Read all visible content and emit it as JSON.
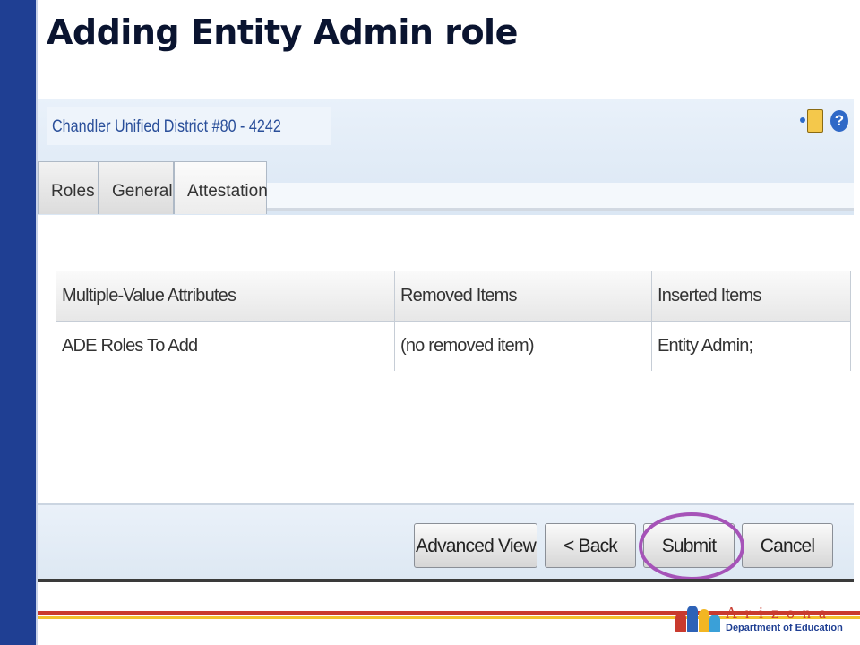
{
  "slide": {
    "title": "Adding Entity Admin role"
  },
  "app": {
    "org_title": "Chandler Unified District #80 - 4242",
    "tabs": [
      {
        "label": "Roles"
      },
      {
        "label": "General"
      },
      {
        "label": "Attestation"
      }
    ],
    "table": {
      "headers": [
        "Multiple-Value Attributes",
        "Removed Items",
        "Inserted Items"
      ],
      "rows": [
        [
          "ADE Roles To Add",
          "(no removed item)",
          "Entity Admin;"
        ]
      ]
    },
    "buttons": {
      "advanced_view": "Advanced View",
      "back": "< Back",
      "submit": "Submit",
      "cancel": "Cancel"
    },
    "icons": [
      "clipboard-icon",
      "help-icon"
    ],
    "help_glyph": "?"
  },
  "logo": {
    "word": "Arizona",
    "subtitle": "Department of Education"
  },
  "colors": {
    "sidebar": "#1f3f93",
    "highlight": "#a653b8",
    "stripe_red": "#c93a2e",
    "stripe_gold": "#f2c12e"
  }
}
